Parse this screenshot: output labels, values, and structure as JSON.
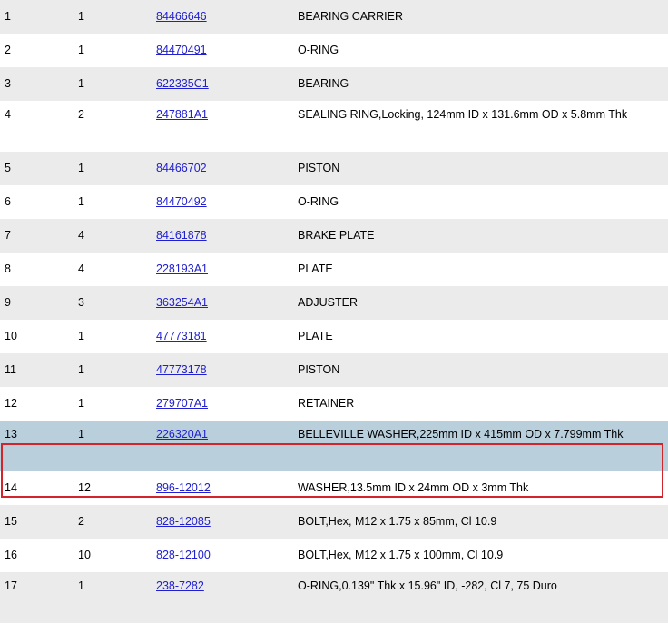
{
  "parts_table": {
    "selected_item": "13",
    "colors": {
      "row_odd": "#ebebeb",
      "row_even": "#ffffff",
      "row_selected": "#b9cfdc",
      "selection_border": "#d4242b",
      "link": "#2020d0"
    },
    "rows": [
      {
        "item": "1",
        "qty": "1",
        "part": "84466646",
        "desc": "BEARING CARRIER"
      },
      {
        "item": "2",
        "qty": "1",
        "part": "84470491",
        "desc": "O-RING"
      },
      {
        "item": "3",
        "qty": "1",
        "part": "622335C1",
        "desc": "BEARING"
      },
      {
        "item": "4",
        "qty": "2",
        "part": "247881A1",
        "desc": "SEALING RING,Locking, 124mm ID x 131.6mm OD x 5.8mm Thk"
      },
      {
        "item": "5",
        "qty": "1",
        "part": "84466702",
        "desc": "PISTON"
      },
      {
        "item": "6",
        "qty": "1",
        "part": "84470492",
        "desc": "O-RING"
      },
      {
        "item": "7",
        "qty": "4",
        "part": "84161878",
        "desc": "BRAKE PLATE"
      },
      {
        "item": "8",
        "qty": "4",
        "part": "228193A1",
        "desc": "PLATE"
      },
      {
        "item": "9",
        "qty": "3",
        "part": "363254A1",
        "desc": "ADJUSTER"
      },
      {
        "item": "10",
        "qty": "1",
        "part": "47773181",
        "desc": "PLATE"
      },
      {
        "item": "11",
        "qty": "1",
        "part": "47773178",
        "desc": "PISTON"
      },
      {
        "item": "12",
        "qty": "1",
        "part": "279707A1",
        "desc": "RETAINER"
      },
      {
        "item": "13",
        "qty": "1",
        "part": "226320A1",
        "desc": "BELLEVILLE WASHER,225mm ID x 415mm OD x 7.799mm Thk"
      },
      {
        "item": "14",
        "qty": "12",
        "part": "896-12012",
        "desc": "WASHER,13.5mm ID x 24mm OD x 3mm Thk"
      },
      {
        "item": "15",
        "qty": "2",
        "part": "828-12085",
        "desc": "BOLT,Hex, M12 x 1.75 x 85mm, Cl 10.9"
      },
      {
        "item": "16",
        "qty": "10",
        "part": "828-12100",
        "desc": "BOLT,Hex, M12 x 1.75 x 100mm, Cl 10.9"
      },
      {
        "item": "17",
        "qty": "1",
        "part": "238-7282",
        "desc": "O-RING,0.139\" Thk x 15.96\" ID, -282, Cl 7, 75 Duro"
      }
    ]
  }
}
